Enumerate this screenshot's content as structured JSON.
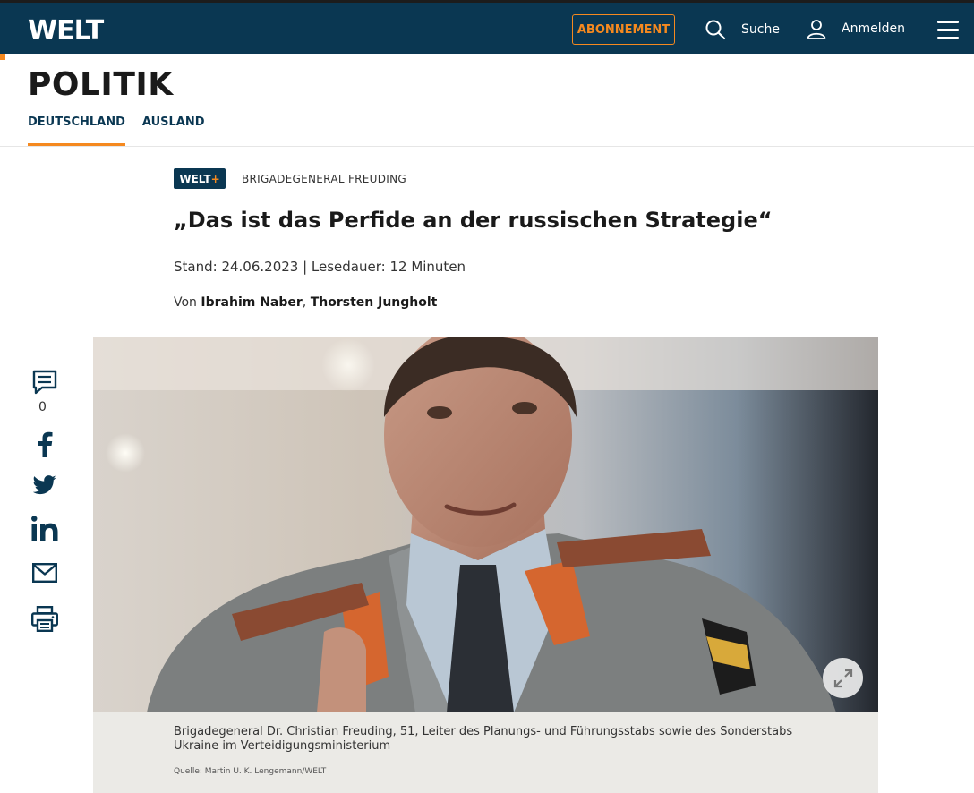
{
  "header": {
    "logo": "WELT",
    "subscribe_label": "ABONNEMENT",
    "search_label": "Suche",
    "login_label": "Anmelden",
    "menu_icon": "hamburger-icon"
  },
  "section": {
    "title": "POLITIK",
    "tabs": [
      {
        "label": "DEUTSCHLAND",
        "active": true
      },
      {
        "label": "AUSLAND",
        "active": false
      }
    ]
  },
  "article": {
    "badge_text": "WELT",
    "badge_plus": "+",
    "kicker": "BRIGADEGENERAL FREUDING",
    "headline": "„Das ist das Perfide an der russischen Strategie“",
    "meta": "Stand: 24.06.2023 | Lesedauer: 12 Minuten",
    "authors_prefix": "Von ",
    "authors": [
      "Ibrahim Naber",
      "Thorsten Jungholt"
    ],
    "author_separator": ", "
  },
  "share": {
    "comment_count": "0",
    "icons": [
      "comment-icon",
      "facebook-icon",
      "twitter-icon",
      "linkedin-icon",
      "mail-icon",
      "print-icon"
    ]
  },
  "image": {
    "caption": "Brigadegeneral Dr. Christian Freuding, 51, Leiter des Planungs- und Führungsstabs sowie des Sonderstabs Ukraine im Verteidigungsministerium",
    "credit": "Quelle: Martin U. K. Lengemann/WELT"
  },
  "colors": {
    "brand_navy": "#0a3752",
    "accent_orange": "#f5891f"
  }
}
